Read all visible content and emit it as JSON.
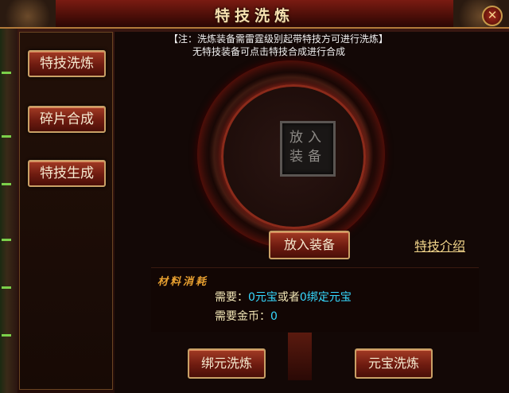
{
  "window": {
    "title": "特技洗炼",
    "close_icon": "close-icon"
  },
  "menu": {
    "items": [
      {
        "label": "特技洗炼"
      },
      {
        "label": "碎片合成"
      },
      {
        "label": "特技生成"
      }
    ]
  },
  "notice": {
    "line1": "【注：洗炼装备需雷霆级别起带特技方可进行洗炼】",
    "line2": "无特技装备可点击特技合成进行合成"
  },
  "slot": {
    "line1": "放入",
    "line2": "装备"
  },
  "actions": {
    "put_equipment": "放入装备",
    "skill_intro": "特技介绍"
  },
  "materials": {
    "title": "材料消耗",
    "need_label": "需要：",
    "yuanbao": "0元宝",
    "or": "或者",
    "bound": "0绑定元宝",
    "gold_label": "需要金币：",
    "gold_value": "0"
  },
  "bottom": {
    "bound_refine": "绑元洗炼",
    "yuanbao_refine": "元宝洗炼"
  },
  "colors": {
    "accent": "#c9a066",
    "value": "#36d9ff",
    "title": "#e8a030"
  }
}
